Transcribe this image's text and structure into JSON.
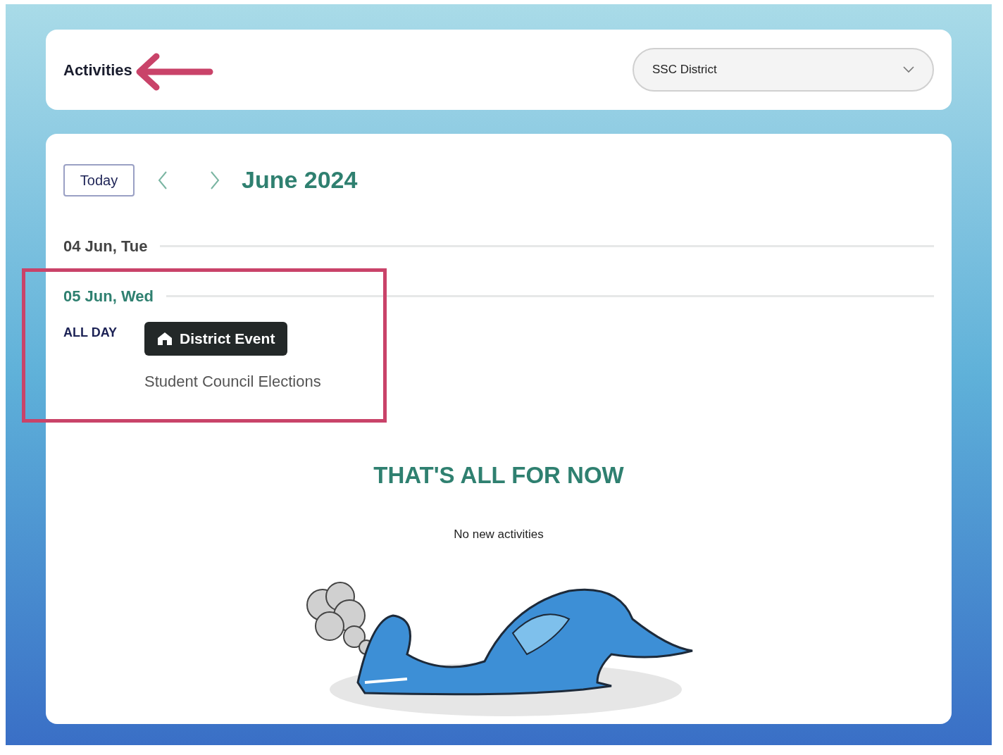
{
  "header": {
    "title": "Activities",
    "district_select": {
      "value": "SSC District"
    }
  },
  "calendar": {
    "today_button": "Today",
    "month": "June 2024",
    "days": [
      {
        "label": "04 Jun, Tue",
        "selected": false
      },
      {
        "label": "05 Jun, Wed",
        "selected": true,
        "events": [
          {
            "time": "ALL DAY",
            "tag": "District Event",
            "title": "Student Council Elections"
          }
        ]
      }
    ]
  },
  "empty_state": {
    "heading": "THAT'S ALL FOR NOW",
    "message": "No new activities"
  }
}
